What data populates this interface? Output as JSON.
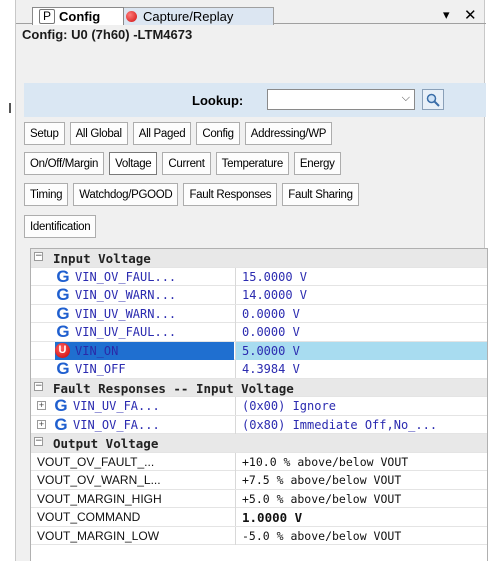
{
  "tabs": {
    "config": {
      "badge": "P",
      "label": "Config"
    },
    "capture": {
      "label": "Capture/Replay"
    },
    "menu_glyph": "▾",
    "close_glyph": "✕"
  },
  "config_title": "Config: U0 (7h60) -LTM4673",
  "lookup": {
    "label": "Lookup:",
    "value": "",
    "dropdown_glyph": "⌵"
  },
  "category_buttons": {
    "row1": [
      "Setup",
      "All Global",
      "All Paged",
      "Config",
      "Addressing/WP"
    ],
    "row2": [
      "On/Off/Margin",
      "Voltage",
      "Current",
      "Temperature",
      "Energy"
    ],
    "row3": [
      "Timing",
      "Watchdog/PGOOD",
      "Fault Responses",
      "Fault Sharing"
    ],
    "row4": [
      "Identification"
    ],
    "active": "Voltage"
  },
  "grid": {
    "input_voltage": {
      "title": "Input Voltage",
      "rows": [
        {
          "icon": "G",
          "name": "VIN_OV_FAUL...",
          "value": "15.0000 V"
        },
        {
          "icon": "G",
          "name": "VIN_OV_WARN...",
          "value": "14.0000 V"
        },
        {
          "icon": "G",
          "name": "VIN_UV_WARN...",
          "value": "0.0000 V"
        },
        {
          "icon": "G",
          "name": "VIN_UV_FAUL...",
          "value": "0.0000 V"
        },
        {
          "icon": "U",
          "name": "VIN_ON",
          "value": "5.0000 V"
        },
        {
          "icon": "G",
          "name": "VIN_OFF",
          "value": "4.3984 V"
        }
      ]
    },
    "fault_responses": {
      "title": "Fault Responses -- Input Voltage",
      "rows": [
        {
          "icon": "G",
          "name": "VIN_UV_FA...",
          "value": "(0x00) Ignore"
        },
        {
          "icon": "G",
          "name": "VIN_OV_FA...",
          "value": "(0x80) Immediate Off,No_..."
        }
      ]
    },
    "output_voltage": {
      "title": "Output Voltage",
      "rows": [
        {
          "name": "VOUT_OV_FAULT_...",
          "value": "+10.0 % above/below VOUT"
        },
        {
          "name": "VOUT_OV_WARN_L...",
          "value": "+7.5 % above/below VOUT"
        },
        {
          "name": "VOUT_MARGIN_HIGH",
          "value": "+5.0 % above/below VOUT"
        },
        {
          "name": "VOUT_COMMAND",
          "value": "1.0000 V"
        },
        {
          "name": "VOUT_MARGIN_LOW",
          "value": "-5.0 % above/below VOUT"
        }
      ]
    }
  }
}
